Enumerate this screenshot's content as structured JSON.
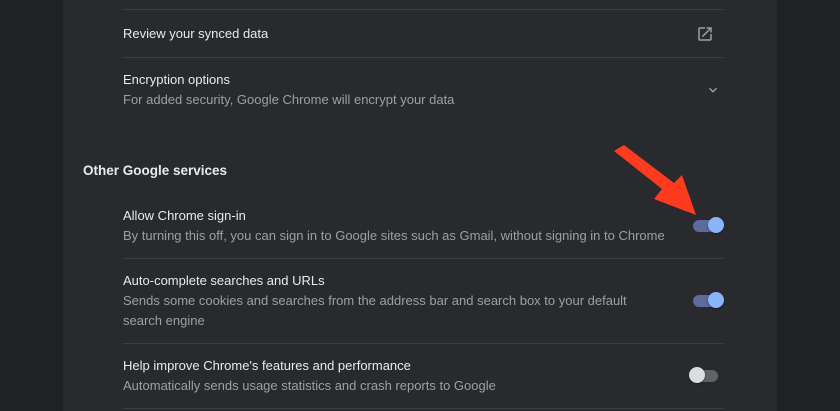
{
  "sync": {
    "review_label": "Review your synced data",
    "review_icon": "open-in-new-icon",
    "encryption_title": "Encryption options",
    "encryption_desc": "For added security, Google Chrome will encrypt your data",
    "encryption_icon": "chevron-down-icon"
  },
  "other_services": {
    "header": "Other Google services",
    "items": [
      {
        "title": "Allow Chrome sign-in",
        "desc": "By turning this off, you can sign in to Google sites such as Gmail, without signing in to Chrome",
        "enabled": true
      },
      {
        "title": "Auto-complete searches and URLs",
        "desc": "Sends some cookies and searches from the address bar and search box to your default search engine",
        "enabled": true
      },
      {
        "title": "Help improve Chrome's features and performance",
        "desc": "Automatically sends usage statistics and crash reports to Google",
        "enabled": false
      }
    ]
  },
  "colors": {
    "background": "#202124",
    "card": "#292a2d",
    "accent": "#8ab4f8",
    "annotation_arrow": "#ff3b1f"
  }
}
